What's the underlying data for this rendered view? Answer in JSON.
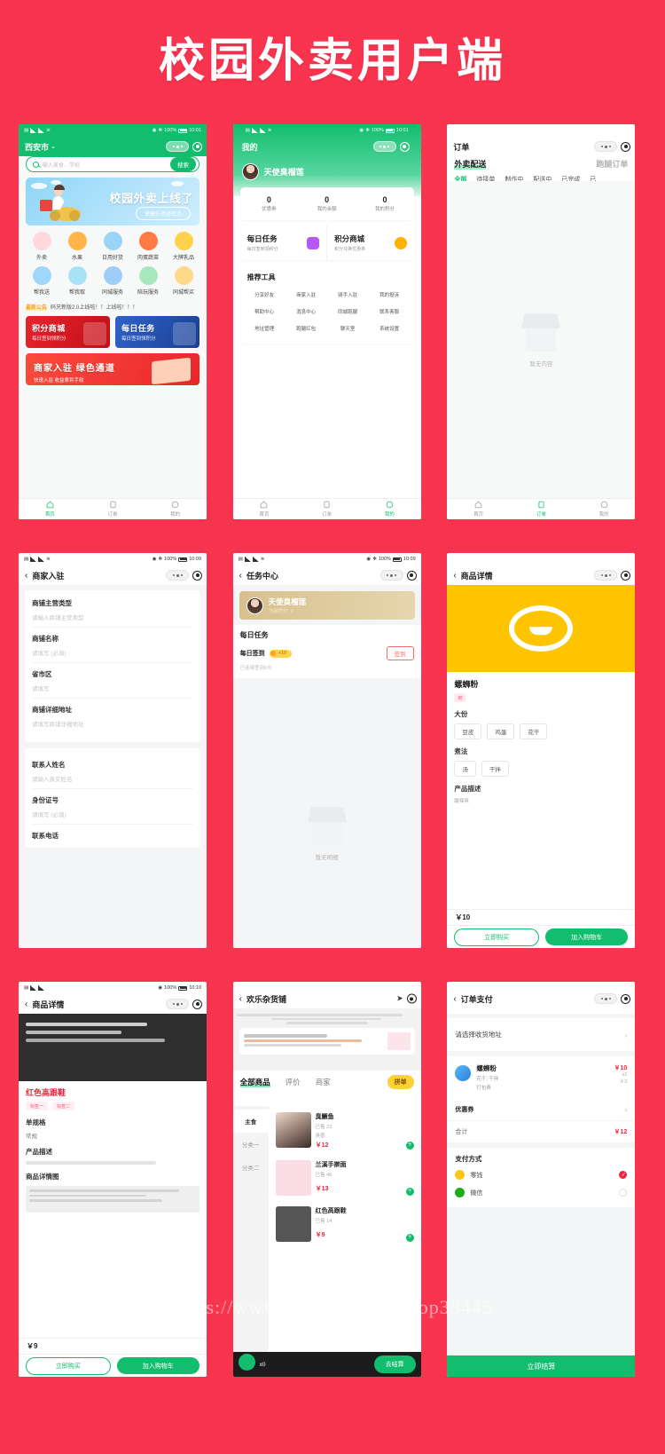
{
  "header": {
    "title": "校园外卖用户端",
    "bg": "#f9344f"
  },
  "watermark": "https://www.huzhan.com/ishop38445",
  "status_bar": {
    "battery": "100%",
    "time1": "10:01",
    "time2": "10:09",
    "time3": "10:10"
  },
  "phone_home": {
    "nav_title": "西安市",
    "nav_chevron": "⌄",
    "search": {
      "placeholder": "输入美食、学校",
      "button": "搜索"
    },
    "banner": {
      "headline": "校园外卖上线了",
      "sub": "便捷外卖轻松点"
    },
    "categories_row1": [
      {
        "label": "外卖",
        "color": "#ffd9dd"
      },
      {
        "label": "水果",
        "color": "#ffb547"
      },
      {
        "label": "日用好货",
        "color": "#4fa9f5"
      },
      {
        "label": "肉蛋蔬菜",
        "color": "#ff7a45"
      },
      {
        "label": "大牌乳品",
        "color": "#ffd24d"
      }
    ],
    "categories_row2": [
      {
        "label": "帮我送",
        "color": "#49a8f0"
      },
      {
        "label": "帮我取",
        "color": "#3fb7e8"
      },
      {
        "label": "同城服务",
        "color": "#2fa5f2"
      },
      {
        "label": "陪玩服务",
        "color": "#49cf7d"
      },
      {
        "label": "同城帮买",
        "color": "#ffc233"
      }
    ],
    "notice": {
      "tag": "最新公告",
      "text": "码兄新版2.0上线啦！！上线啦！！！"
    },
    "promos": [
      {
        "title": "积分商城",
        "sub": "每日签到领积分",
        "style": "red"
      },
      {
        "title": "每日任务",
        "sub": "每日签到领积分",
        "style": "blue"
      }
    ],
    "wide_promo": {
      "title": "商家入驻 绿色通道",
      "sub": "快速入驻 收益拿到手软"
    },
    "tabbar": [
      {
        "label": "首页",
        "icon": "home-icon",
        "active": true
      },
      {
        "label": "订单",
        "icon": "order-icon",
        "active": false
      },
      {
        "label": "我的",
        "icon": "user-icon",
        "active": false
      }
    ]
  },
  "phone_mine": {
    "nav_title": "我的",
    "user_name": "天使臭榴莲",
    "stats": [
      {
        "value": "0",
        "label": "优惠券"
      },
      {
        "value": "0",
        "label": "我的余额"
      },
      {
        "value": "0",
        "label": "我的积分"
      }
    ],
    "entries": [
      {
        "title": "每日任务",
        "sub": "每日签到领积分",
        "color": "#b558f6"
      },
      {
        "title": "积分商城",
        "sub": "积分兑换优惠券",
        "color": "#ffb300"
      }
    ],
    "tools_title": "推荐工具",
    "tools": [
      {
        "label": "分享好友",
        "color": "#a259f7"
      },
      {
        "label": "商家入驻",
        "color": "#ff8a3c"
      },
      {
        "label": "骑手入驻",
        "color": "#ff6b3d"
      },
      {
        "label": "我的投诉",
        "color": "#e8364a"
      },
      {
        "label": "帮助中心",
        "color": "#2eb872"
      },
      {
        "label": "消息中心",
        "color": "#2f8ef4"
      },
      {
        "label": "同城跑腿",
        "color": "#f0433c"
      },
      {
        "label": "联系客服",
        "color": "#16b06a"
      },
      {
        "label": "地址管理",
        "color": "#ffc61a"
      },
      {
        "label": "跑腿红包",
        "color": "#f0433c"
      },
      {
        "label": "聊天室",
        "color": "#ffc61a"
      },
      {
        "label": "系统设置",
        "color": "#2f8ef4"
      }
    ],
    "tabbar": [
      {
        "label": "首页",
        "active": false
      },
      {
        "label": "订单",
        "active": false
      },
      {
        "label": "我的",
        "active": true
      }
    ]
  },
  "phone_orders": {
    "nav_title": "订单",
    "tabs": [
      {
        "label": "外卖配送",
        "active": true
      },
      {
        "label": "跑腿订单",
        "active": false
      }
    ],
    "sub_tabs": [
      {
        "label": "全部",
        "active": true
      },
      {
        "label": "待接单",
        "active": false
      },
      {
        "label": "制作中",
        "active": false
      },
      {
        "label": "配送中",
        "active": false
      },
      {
        "label": "已完成",
        "active": false
      },
      {
        "label": "已",
        "active": false
      }
    ],
    "empty_text": "暂无内容",
    "tabbar": [
      {
        "label": "首页",
        "active": false
      },
      {
        "label": "订单",
        "active": true
      },
      {
        "label": "我的",
        "active": false
      }
    ]
  },
  "phone_merchant_apply": {
    "nav_title": "商家入驻",
    "group1": [
      {
        "label": "商铺主营类型",
        "placeholder": "请输入商铺主营类型"
      },
      {
        "label": "商铺名称",
        "placeholder": "请填写 (必填)"
      },
      {
        "label": "省市区",
        "placeholder": "请填写"
      },
      {
        "label": "商铺详细地址",
        "placeholder": "请填写商铺详细地址"
      }
    ],
    "group2": [
      {
        "label": "联系人姓名",
        "placeholder": "请输入真实姓名"
      },
      {
        "label": "身份证号",
        "placeholder": "请填写 (必填)"
      },
      {
        "label": "联系电话",
        "placeholder": ""
      }
    ]
  },
  "phone_task": {
    "nav_title": "任务中心",
    "user_name": "天使臭榴莲",
    "user_points_label": "当前积分",
    "user_points": "0",
    "section_title": "每日任务",
    "task_name": "每日签到",
    "task_points": "+10",
    "task_button": "签到",
    "task_sub": "已连续签到0天",
    "empty_text": "暂无明细"
  },
  "phone_product": {
    "nav_title": "商品详情",
    "name": "螺蛳粉",
    "badge": "鲜",
    "spec1_title": "大份",
    "spec1_options": [
      "豆皮",
      "鸡蛋",
      "花干"
    ],
    "spec2_title": "煮法",
    "spec2_options": [
      "汤",
      "干拌"
    ],
    "desc_title": "产品描述",
    "desc_text": "酸辣爽",
    "price": "￥10",
    "btn_buy": "立即购买",
    "btn_cart": "加入购物车"
  },
  "phone_product2": {
    "nav_title": "商品详情",
    "name": "红色高跟鞋",
    "badges": [
      "标签一",
      "标签二"
    ],
    "spec_title": "单规格",
    "spec_value": "常规",
    "desc_title": "产品描述",
    "detail_title": "商品详情图",
    "price": "￥9",
    "btn_buy": "立即购买",
    "btn_cart": "加入购物车"
  },
  "phone_shop": {
    "nav_title": "欢乐杂货铺",
    "tabs": [
      {
        "label": "全部商品",
        "active": true
      },
      {
        "label": "评价",
        "active": false
      },
      {
        "label": "商家",
        "active": false
      }
    ],
    "pin_button": "拼单",
    "side_cats": [
      {
        "label": "主食",
        "active": true
      },
      {
        "label": "分类一",
        "active": false
      },
      {
        "label": "分类二",
        "active": false
      }
    ],
    "goods": [
      {
        "name": "臭鳜鱼",
        "sold": "已售 23",
        "tag": "臭香",
        "price": "￥12"
      },
      {
        "name": "兰溪手擀面",
        "sold": "已售 46",
        "tag": "",
        "price": "￥13"
      },
      {
        "name": "红色高跟鞋",
        "sold": "已售 14",
        "tag": "",
        "price": "￥9"
      }
    ],
    "cart_count": "x0",
    "cart_button": "去结算"
  },
  "phone_pay": {
    "nav_title": "订单支付",
    "address_placeholder": "请选择收货地址",
    "item": {
      "name": "螺蛳粉",
      "spec": "花干, 干拌",
      "fee_label": "打包费",
      "price": "￥10",
      "qty": "x1",
      "fee": "￥2"
    },
    "coupon_label": "优惠券",
    "total_label": "合计",
    "total_value": "￥12",
    "pay_title": "支付方式",
    "methods": [
      {
        "label": "零钱",
        "selected": true,
        "color": "#ffc61a"
      },
      {
        "label": "微信",
        "selected": false,
        "color": "#1aad19"
      }
    ],
    "submit": "立即结算"
  }
}
